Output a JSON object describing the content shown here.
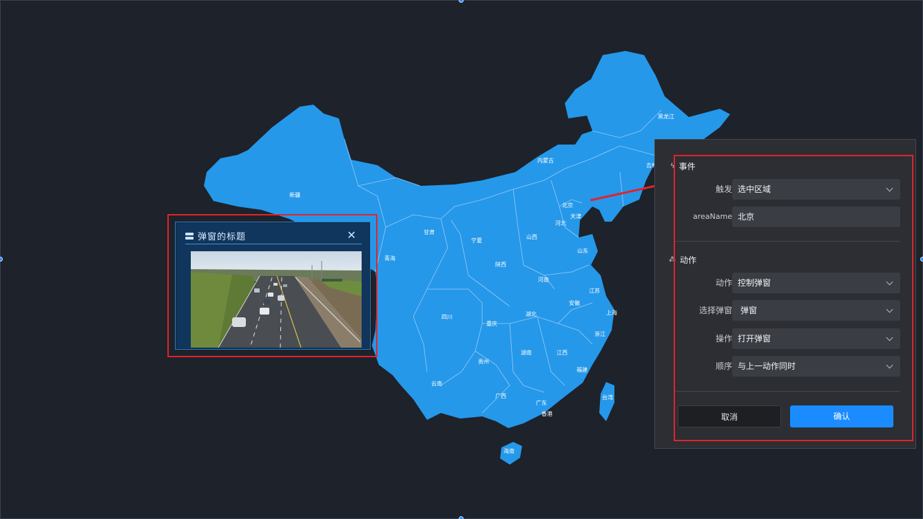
{
  "map": {
    "fill_color": "#2598ea",
    "border_color": "#9ccbf3",
    "labels": [
      "黑龙江",
      "吉林",
      "内蒙古",
      "新疆",
      "北京",
      "天津",
      "河北",
      "甘肃",
      "宁夏",
      "山西",
      "山东",
      "青海",
      "陕西",
      "河南",
      "江苏",
      "安徽",
      "上海",
      "四川",
      "湖北",
      "重庆",
      "浙江",
      "湖南",
      "江西",
      "贵州",
      "福建",
      "云南",
      "广西",
      "广东",
      "香港",
      "台湾",
      "海南"
    ]
  },
  "popup": {
    "title": "弹窗的标题",
    "close_icon": "close-icon",
    "image_desc_icon": "highway-video-frame"
  },
  "panel": {
    "event_section": {
      "title": "事件",
      "icon": "lightning-icon"
    },
    "trigger": {
      "label": "触发",
      "value": "选中区域"
    },
    "area_name": {
      "label": "areaName",
      "value": "北京"
    },
    "action_section": {
      "title": "动作",
      "icon": "action-icon"
    },
    "action": {
      "label": "动作",
      "value": "控制弹窗"
    },
    "select_popup": {
      "label": "选择弹窗",
      "value": "弹窗"
    },
    "operation": {
      "label": "操作",
      "value": "打开弹窗"
    },
    "order": {
      "label": "顺序",
      "value": "与上一动作同时"
    },
    "cancel_label": "取消",
    "confirm_label": "确认"
  },
  "colors": {
    "accent": "#1a8cff",
    "highlight": "#e0242b",
    "background": "#1e222a"
  }
}
